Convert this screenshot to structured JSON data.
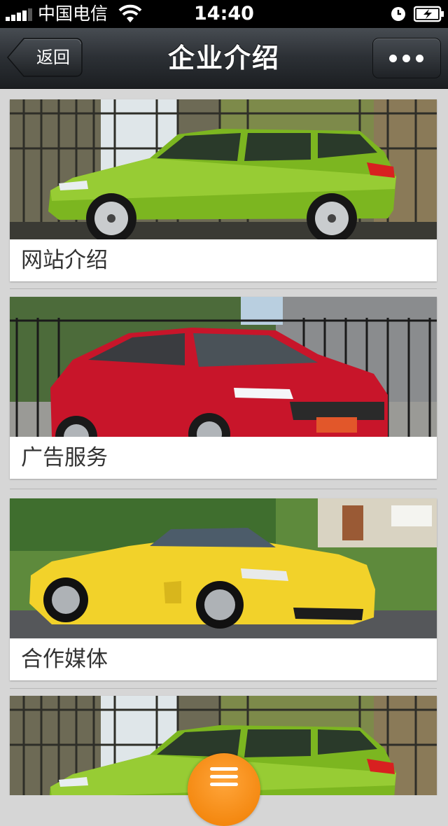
{
  "status_bar": {
    "carrier": "中国电信",
    "time": "14:40"
  },
  "nav": {
    "back_label": "返回",
    "title": "企业介绍"
  },
  "cards": [
    {
      "label": "网站介绍",
      "image": "green-minivan-photo"
    },
    {
      "label": "广告服务",
      "image": "red-sedan-photo"
    },
    {
      "label": "合作媒体",
      "image": "yellow-convertible-photo"
    },
    {
      "label": "",
      "image": "green-minivan-photo"
    }
  ],
  "colors": {
    "accent": "#f58a0b",
    "nav_bar": "#2c3035",
    "page_background": "#d6d6d6"
  }
}
